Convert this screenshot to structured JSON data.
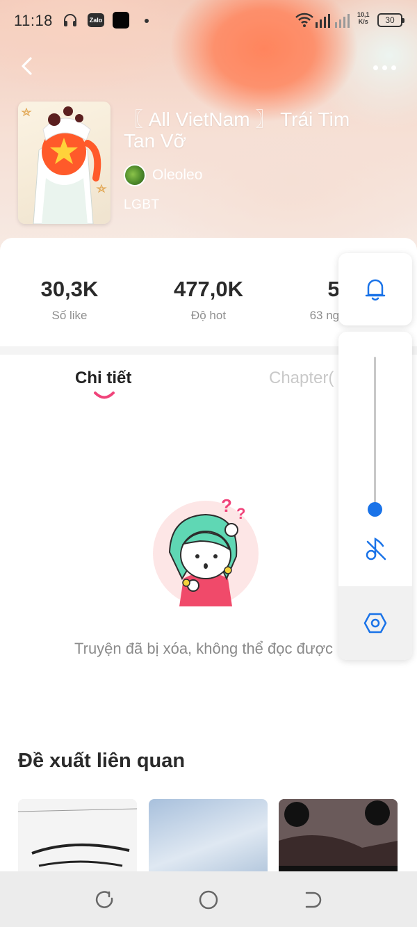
{
  "status_bar": {
    "time": "11:18",
    "zalo_label": "Zalo",
    "net_speed_value": "10,1",
    "net_speed_unit": "K/s",
    "battery": "30"
  },
  "book": {
    "title": "〖 All VietNam 〗 Trái Tim Tan Vỡ",
    "author": "Oleoleo",
    "genre": "LGBT"
  },
  "stats": [
    {
      "value": "30,3K",
      "label": "Số like"
    },
    {
      "value": "477,0K",
      "label": "Độ hot"
    },
    {
      "value": "5",
      "label": "63 người"
    }
  ],
  "tabs": {
    "details": "Chi tiết",
    "chapters": "Chapter("
  },
  "empty_state": {
    "message": "Truyện đã bị xóa, không thể đọc được"
  },
  "related": {
    "title": "Đề xuất liên quan"
  },
  "colors": {
    "accent_pink": "#f0437a",
    "volume_blue": "#1a73e8"
  },
  "icons": {
    "back": "back-arrow-icon",
    "more": "more-dots-icon",
    "bell": "bell-icon",
    "mute": "music-note-off-icon",
    "settings": "hexagon-settings-icon"
  }
}
